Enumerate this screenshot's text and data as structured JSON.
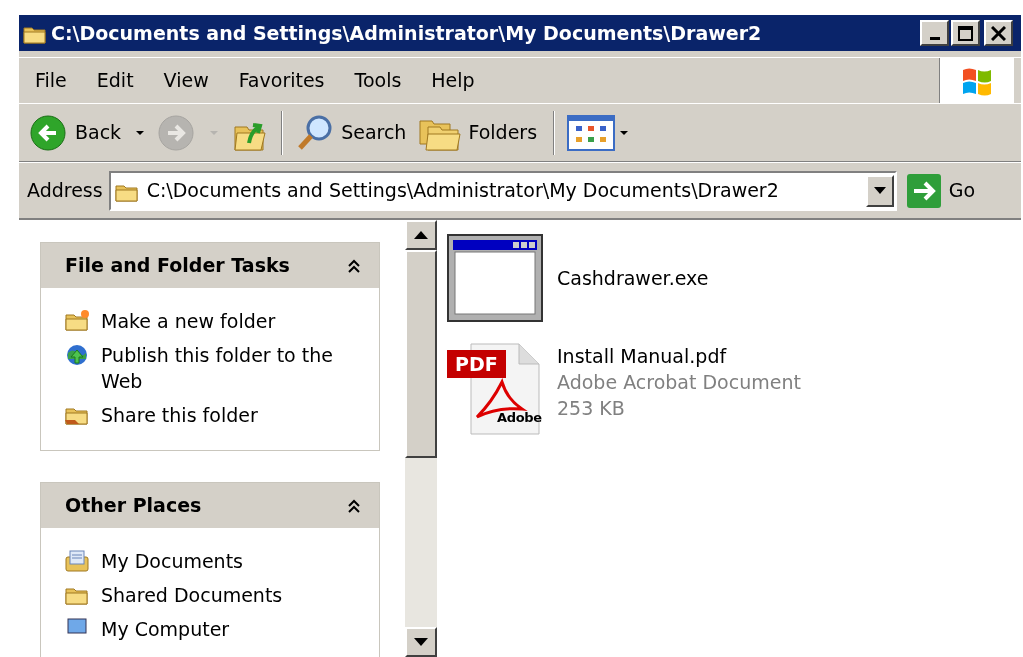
{
  "window": {
    "title": "C:\\Documents and Settings\\Administrator\\My Documents\\Drawer2"
  },
  "menu": [
    {
      "label": "File"
    },
    {
      "label": "Edit"
    },
    {
      "label": "View"
    },
    {
      "label": "Favorites"
    },
    {
      "label": "Tools"
    },
    {
      "label": "Help"
    }
  ],
  "toolbar": [
    {
      "kind": "back",
      "label": "Back",
      "disabled": false
    },
    {
      "kind": "forward",
      "disabled": true
    },
    {
      "kind": "up"
    },
    {
      "kind": "search",
      "label": "Search"
    },
    {
      "kind": "folders",
      "label": "Folders"
    },
    {
      "kind": "views"
    }
  ],
  "address": {
    "label": "Address",
    "value": "C:\\Documents and Settings\\Administrator\\My Documents\\Drawer2",
    "go": "Go"
  },
  "sidebar": [
    {
      "title": "File and Folder Tasks",
      "expanded": true,
      "items": [
        {
          "kind": "newfolder",
          "label": "Make a new folder"
        },
        {
          "kind": "publish",
          "label": "Publish this folder to the Web"
        },
        {
          "kind": "share",
          "label": "Share this folder"
        }
      ]
    },
    {
      "title": "Other Places",
      "expanded": true,
      "items": [
        {
          "kind": "mydocs",
          "label": "My Documents"
        },
        {
          "kind": "shared",
          "label": "Shared Documents"
        },
        {
          "kind": "computer",
          "label": "My Computer"
        }
      ]
    }
  ],
  "files": [
    {
      "kind": "exe",
      "name": "Cashdrawer.exe"
    },
    {
      "kind": "pdf",
      "name": "Install Manual.pdf",
      "type": "Adobe Acrobat Document",
      "size": "253 KB",
      "icon_label": "PDF",
      "icon_brand": "Adobe"
    }
  ]
}
